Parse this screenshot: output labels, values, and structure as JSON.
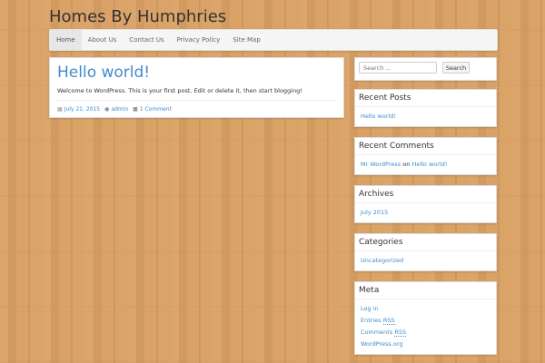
{
  "site": {
    "title": "Homes By Humphries"
  },
  "nav": {
    "items": [
      {
        "label": "Home"
      },
      {
        "label": "About Us"
      },
      {
        "label": "Contact Us"
      },
      {
        "label": "Privacy Policy"
      },
      {
        "label": "Site Map"
      }
    ]
  },
  "post": {
    "title": "Hello world!",
    "excerpt": "Welcome to WordPress. This is your first post. Edit or delete it, then start blogging!",
    "date": "July 21, 2015",
    "author": "admin",
    "comments": "1 Comment"
  },
  "search": {
    "placeholder": "Search ...",
    "button_label": "Search"
  },
  "recent_posts": {
    "title": "Recent Posts",
    "items": [
      "Hello world!"
    ]
  },
  "recent_comments": {
    "title": "Recent Comments",
    "author": "Mr WordPress",
    "on": "on",
    "post": "Hello world!"
  },
  "archives": {
    "title": "Archives",
    "items": [
      "July 2015"
    ]
  },
  "categories": {
    "title": "Categories",
    "items": [
      "Uncategorized"
    ]
  },
  "meta": {
    "title": "Meta",
    "login": "Log in",
    "entries_prefix": "Entries ",
    "entries_abbr": "RSS",
    "comments_prefix": "Comments ",
    "comments_abbr": "RSS",
    "wordpress": "WordPress.org"
  },
  "colors": {
    "link": "#428bca",
    "background": "#d9a063"
  }
}
